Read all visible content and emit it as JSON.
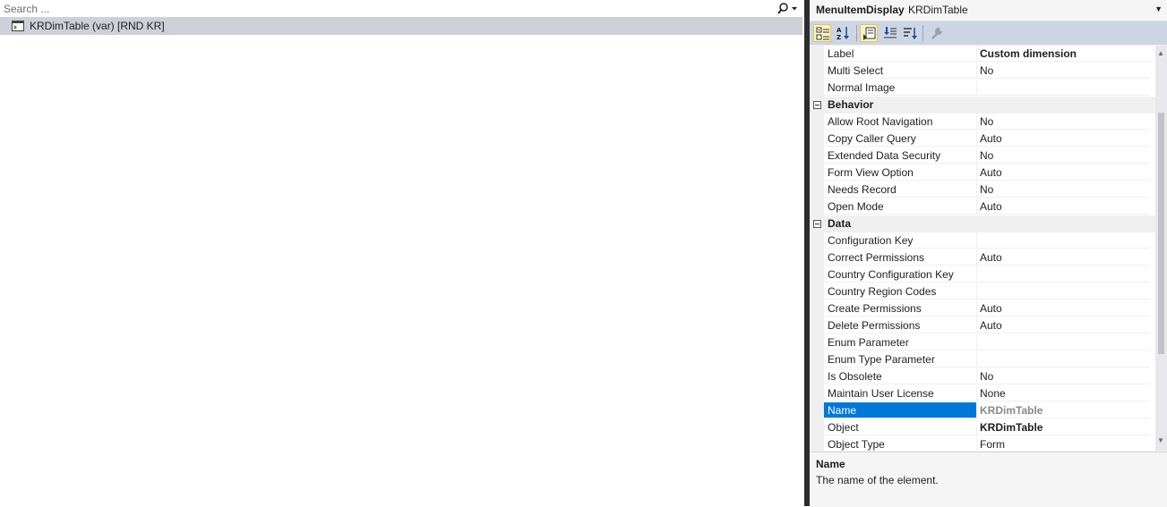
{
  "search": {
    "placeholder": "Search ...",
    "value": ""
  },
  "tree": {
    "item_label": "KRDimTable (var) [RND KR]"
  },
  "properties_header": {
    "object_type": "MenuItemDisplay",
    "object_name": "KRDimTable"
  },
  "toolbar": {
    "icons": [
      "categorized-icon",
      "alphabetical-icon",
      "property-pages-icon",
      "events-icon",
      "sort-icon",
      "wrench-icon"
    ]
  },
  "property_rows": [
    {
      "name": "Label",
      "value": "Custom dimension",
      "style": "bold"
    },
    {
      "name": "Multi Select",
      "value": "No"
    },
    {
      "name": "Normal Image",
      "value": ""
    },
    {
      "category": "Behavior"
    },
    {
      "name": "Allow Root Navigation",
      "value": "No"
    },
    {
      "name": "Copy Caller Query",
      "value": "Auto"
    },
    {
      "name": "Extended Data Security",
      "value": "No"
    },
    {
      "name": "Form View Option",
      "value": "Auto"
    },
    {
      "name": "Needs Record",
      "value": "No"
    },
    {
      "name": "Open Mode",
      "value": "Auto"
    },
    {
      "category": "Data"
    },
    {
      "name": "Configuration Key",
      "value": ""
    },
    {
      "name": "Correct Permissions",
      "value": "Auto"
    },
    {
      "name": "Country Configuration Key",
      "value": ""
    },
    {
      "name": "Country Region Codes",
      "value": ""
    },
    {
      "name": "Create Permissions",
      "value": "Auto"
    },
    {
      "name": "Delete Permissions",
      "value": "Auto"
    },
    {
      "name": "Enum Parameter",
      "value": ""
    },
    {
      "name": "Enum Type Parameter",
      "value": ""
    },
    {
      "name": "Is Obsolete",
      "value": "No"
    },
    {
      "name": "Maintain User License",
      "value": "None"
    },
    {
      "name": "Name",
      "value": "KRDimTable",
      "style": "grey",
      "selected": true
    },
    {
      "name": "Object",
      "value": "KRDimTable",
      "style": "bold"
    },
    {
      "name": "Object Type",
      "value": "Form"
    }
  ],
  "description": {
    "title": "Name",
    "text": "The name of the element."
  },
  "colors": {
    "selection": "#0078d7",
    "toolbar": "#cdd5e4",
    "tree_selection": "#cdd0d9",
    "splitter": "#2d2d30"
  }
}
